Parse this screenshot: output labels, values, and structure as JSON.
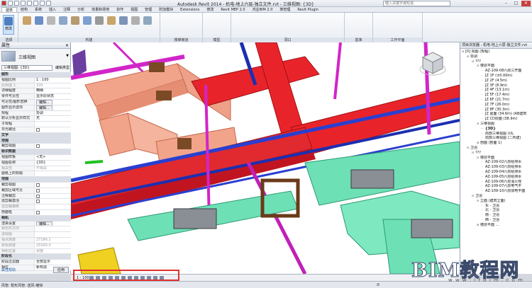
{
  "titlebar": {
    "title": "Autodesk Revit 2014 -   机电-地上六层-独立文件.rvt - 三维视图: {3D}",
    "search_placeholder": "键入关键字或短语"
  },
  "tabs": [
    "建筑",
    "结构",
    "系统",
    "插入",
    "注释",
    "分析",
    "体量和场地",
    "协作",
    "视图",
    "管理",
    "附加模块",
    "Extensions",
    "修改",
    "Revit MEP 2.0",
    "鸿业BIM 2.0",
    "族管理",
    "Revit Plugin"
  ],
  "ribbon": {
    "groups": [
      "选择",
      "构建",
      "楼梯坡道",
      "模型",
      "洞口",
      "基准",
      "工作平面"
    ],
    "select_label": "修改"
  },
  "properties": {
    "header": "属性",
    "type_name": "三维视图",
    "type_selector": "三维视图: {3D}",
    "edit_type": "编辑类型",
    "rows": [
      {
        "k": "图形",
        "group": true
      },
      {
        "k": "视图比例",
        "v": "1 : 100"
      },
      {
        "k": "比例值 1:",
        "v": "100",
        "dim": true
      },
      {
        "k": "详细程度",
        "v": "精细"
      },
      {
        "k": "零件可见性",
        "v": "显示原状态"
      },
      {
        "k": "可见性/图形替换",
        "v": "编辑..."
      },
      {
        "k": "图形显示选项",
        "v": "编辑..."
      },
      {
        "k": "规程",
        "v": "协调"
      },
      {
        "k": "默认分析显示样式",
        "v": "无"
      },
      {
        "k": "子规程",
        "v": ""
      },
      {
        "k": "日光路径",
        "v": "",
        "cb": true
      },
      {
        "k": "文字",
        "group": true
      },
      {
        "k": "范围",
        "group": true
      },
      {
        "k": "裁剪视图",
        "v": "",
        "cb": true
      },
      {
        "k": "标识数据",
        "group": true
      },
      {
        "k": "视图样板",
        "v": "<无>"
      },
      {
        "k": "视图名称",
        "v": "{3D}"
      },
      {
        "k": "相关性",
        "v": "不相关",
        "dim": true
      },
      {
        "k": "图纸上的标题",
        "v": ""
      },
      {
        "k": "范围",
        "group": true
      },
      {
        "k": "裁剪视图",
        "v": "",
        "cb": true
      },
      {
        "k": "裁剪区域可见",
        "v": "",
        "cb": true
      },
      {
        "k": "注释裁剪",
        "v": "",
        "cb": true
      },
      {
        "k": "远剪裁激活",
        "v": "",
        "cb": true
      },
      {
        "k": "远剪裁偏移",
        "v": "",
        "dim": true
      },
      {
        "k": "剖面框",
        "v": "",
        "cb": true
      },
      {
        "k": "相机",
        "group": true
      },
      {
        "k": "渲染设置",
        "v": "编辑..."
      },
      {
        "k": "锁定的方向",
        "v": "",
        "dim": true
      },
      {
        "k": "透视图",
        "v": "",
        "dim": true
      },
      {
        "k": "视点高度",
        "v": "27186.1",
        "dim": true
      },
      {
        "k": "目标高度",
        "v": "25500.0",
        "dim": true
      },
      {
        "k": "相机位置",
        "v": "调整",
        "dim": true
      },
      {
        "k": "阶段化",
        "group": true
      },
      {
        "k": "阶段过滤器",
        "v": "全部显示"
      },
      {
        "k": "相位",
        "v": "新构造"
      }
    ],
    "help_link": "属性帮助",
    "apply": "应用"
  },
  "browser": {
    "header": "项目浏览器 - 机电-地上六层-独立文件.rvt",
    "items": [
      {
        "t": "[0] 视图 (规程)",
        "d": 0,
        "tg": "⊟"
      },
      {
        "t": "协调",
        "d": 1,
        "tg": "⊟"
      },
      {
        "t": "???",
        "d": 2,
        "tg": "⊟"
      },
      {
        "t": "楼层平面",
        "d": 3,
        "tg": "⊟"
      },
      {
        "t": "AZ-109-08六层三开面",
        "d": 4
      },
      {
        "t": "JZ 1F (±0.00m)",
        "d": 4
      },
      {
        "t": "JZ 2F (4.5m)",
        "d": 4
      },
      {
        "t": "JZ 3F (8.9m)",
        "d": 4
      },
      {
        "t": "JZ 4F (13.1m)",
        "d": 4
      },
      {
        "t": "JZ 5F (17.4m)",
        "d": 4
      },
      {
        "t": "JZ 6F (21.7m)",
        "d": 4
      },
      {
        "t": "JZ 7F (26.0m)",
        "d": 4
      },
      {
        "t": "JZ 8F (30.3m)",
        "d": 4
      },
      {
        "t": "JZ 屋面 (34.6m) (AB建筑",
        "d": 4
      },
      {
        "t": "JZ CD层面 (38.9m)",
        "d": 4
      },
      {
        "t": "三维视图",
        "d": 3,
        "tg": "⊟"
      },
      {
        "t": "{3D}",
        "d": 4,
        "bold": true
      },
      {
        "t": "局部三维视图 (UL",
        "d": 4
      },
      {
        "t": "局部三维视图 (二所建)",
        "d": 4
      },
      {
        "t": "剖面 (剖面 1)",
        "d": 3,
        "tg": "⊞"
      },
      {
        "t": "卫浴",
        "d": 1,
        "tg": "⊟"
      },
      {
        "t": "???",
        "d": 2,
        "tg": "⊟"
      },
      {
        "t": "楼层平面",
        "d": 3,
        "tg": "⊟"
      },
      {
        "t": "AZ-109-02六层给排水",
        "d": 4
      },
      {
        "t": "AZ-109-03六层给排水",
        "d": 4
      },
      {
        "t": "AZ-109-04六层给排水",
        "d": 4
      },
      {
        "t": "AZ-109-05六层给排水",
        "d": 4
      },
      {
        "t": "AZ-109-06六层消火栓",
        "d": 4
      },
      {
        "t": "AZ-109-07六层电气平",
        "d": 4
      },
      {
        "t": "AZ-109-10六层弱电平面",
        "d": 4
      },
      {
        "t": "卫浴",
        "d": 2,
        "tg": "⊟"
      },
      {
        "t": "立面 (建筑立面)",
        "d": 3,
        "tg": "⊟"
      },
      {
        "t": "东 - 卫浴",
        "d": 4
      },
      {
        "t": "北 - 卫浴",
        "d": 4
      },
      {
        "t": "南 - 卫浴",
        "d": 4
      },
      {
        "t": "西 - 卫浴",
        "d": 4
      },
      {
        "t": "楼层平面 ...",
        "d": 3,
        "tg": "⊞"
      }
    ]
  },
  "viewbar": {
    "scale": "1 : 100"
  },
  "status": {
    "text": "风管: 矩形风管: 送风-镀锌",
    "right": ":0"
  },
  "watermark": {
    "main": "BIM教程网",
    "url": "w w w . i f b i m . c o m"
  }
}
